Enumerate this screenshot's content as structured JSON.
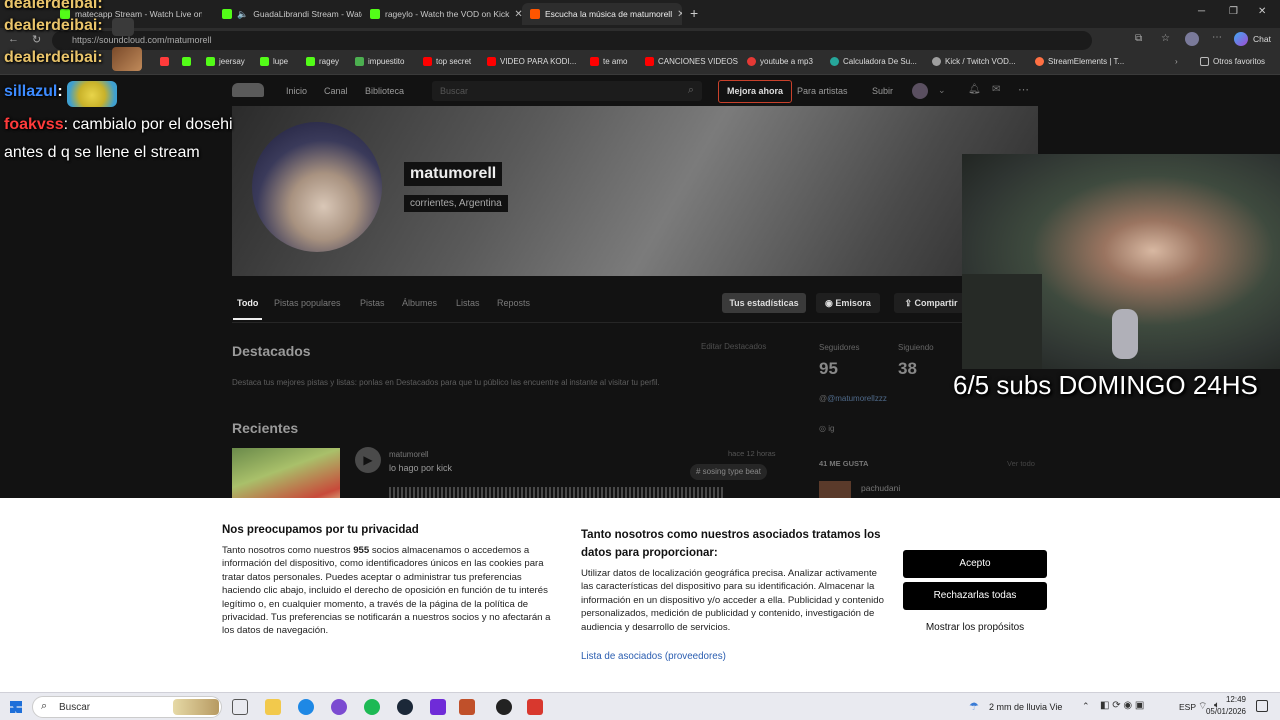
{
  "browser": {
    "tabs": [
      {
        "label": "matecapp Stream - Watch Live on...",
        "color": "#53fc18",
        "active": false
      },
      {
        "label": "GuadaLibrandi Stream - Watc",
        "color": "#53fc18",
        "active": false
      },
      {
        "label": "rageylo - Watch the VOD on Kick",
        "color": "#53fc18",
        "active": false
      },
      {
        "label": "Escucha la música de matumorell",
        "color": "#ff5500",
        "active": true
      }
    ],
    "url": "https://soundcloud.com/matumorell",
    "bookmarks": [
      {
        "label": "jeersay",
        "color": "#53fc18"
      },
      {
        "label": "lupe",
        "color": "#53fc18"
      },
      {
        "label": "ragey",
        "color": "#53fc18"
      },
      {
        "label": "impuestito",
        "color": "#4caf50"
      },
      {
        "label": "top secret",
        "color": "#ff0000"
      },
      {
        "label": "VIDEO PARA KODI...",
        "color": "#ff0000"
      },
      {
        "label": "te amo",
        "color": "#ff0000"
      },
      {
        "label": "CANCIONES VIDEOS",
        "color": "#ff0000"
      },
      {
        "label": "youtube a mp3",
        "color": "#e53935"
      },
      {
        "label": "Calculadora De Su...",
        "color": "#26a69a"
      },
      {
        "label": "Kick / Twitch VOD...",
        "color": "#9e9e9e"
      },
      {
        "label": "StreamElements | T...",
        "color": "#ff7043"
      }
    ],
    "other_favorites": "Otros favoritos",
    "chat_label": "Chat"
  },
  "soundcloud": {
    "nav": {
      "home": "Inicio",
      "feed": "Canal",
      "library": "Biblioteca",
      "search_placeholder": "Buscar",
      "upgrade": "Mejora ahora",
      "for_artists": "Para artistas",
      "upload": "Subir"
    },
    "profile": {
      "name": "matumorell",
      "location": "corrientes, Argentina"
    },
    "tabs": [
      "Todo",
      "Pistas populares",
      "Pistas",
      "Álbumes",
      "Listas",
      "Reposts"
    ],
    "buttons": {
      "stats": "Tus estadísticas",
      "station": "Emisora",
      "share": "Compartir"
    },
    "featured": {
      "title": "Destacados",
      "edit": "Editar Destacados",
      "hint": "Destaca tus mejores pistas y listas: ponlas en Destacados para que tu público las encuentre al instante al visitar tu perfil."
    },
    "stats": {
      "followers_label": "Seguidores",
      "followers": "95",
      "following_label": "Siguiendo",
      "following": "38"
    },
    "links": {
      "handle": "@matumorellzzz",
      "ig": "ig"
    },
    "likes": {
      "title": "41 ME GUSTA",
      "see_all": "Ver todo",
      "first": "pachudani"
    },
    "recent": {
      "title": "Recientes",
      "track_user": "matumorell",
      "track_title": "lo hago por kick",
      "time": "hace 12 horas",
      "tag": "# sosing type beat"
    }
  },
  "overlay": {
    "chat": [
      {
        "user": "dealerdeibai:",
        "user_color": "#e9c46a",
        "text": ""
      },
      {
        "user": "dealerdeibai:",
        "user_color": "#e9c46a",
        "text": ""
      },
      {
        "user": "sillazul",
        "user_color": "#3d8bff",
        "text": ":"
      },
      {
        "user": "foakvss",
        "user_color": "#ff3b3b",
        "text": ": cambialo por el dosehi"
      }
    ],
    "chat_line2": "antes d q se llene el stream",
    "subs_text": "6/5 subs DOMINGO 24HS"
  },
  "consent": {
    "title": "Nos preocupamos por tu privacidad",
    "body_a": "Tanto nosotros como nuestros ",
    "partners_count": "955",
    "body_b": " socios almacenamos o accedemos a información del dispositivo, como identificadores únicos en las cookies para tratar datos personales. Puedes aceptar o administrar tus preferencias haciendo clic abajo, incluido el derecho de oposición en función de tu interés legítimo o, en cualquier momento, a través de la página de la política de privacidad. Tus preferencias se notificarán a nuestros socios y no afectarán a los datos de navegación.",
    "right_title": "Tanto nosotros como nuestros asociados tratamos los datos para proporcionar:",
    "right_body": "Utilizar datos de localización geográfica precisa. Analizar activamente las características del dispositivo para su identificación. Almacenar la información en un dispositivo y/o acceder a ella. Publicidad y contenido personalizados, medición de publicidad y contenido, investigación de audiencia y desarrollo de servicios.",
    "partners_link": "Lista de asociados (proveedores)",
    "accept": "Acepto",
    "reject": "Rechazarlas todas",
    "purposes": "Mostrar los propósitos"
  },
  "taskbar": {
    "search": "Buscar",
    "weather": "2 mm de lluvia Vie",
    "lang": "ESP",
    "time": "12:49",
    "date": "05/01/2026"
  }
}
